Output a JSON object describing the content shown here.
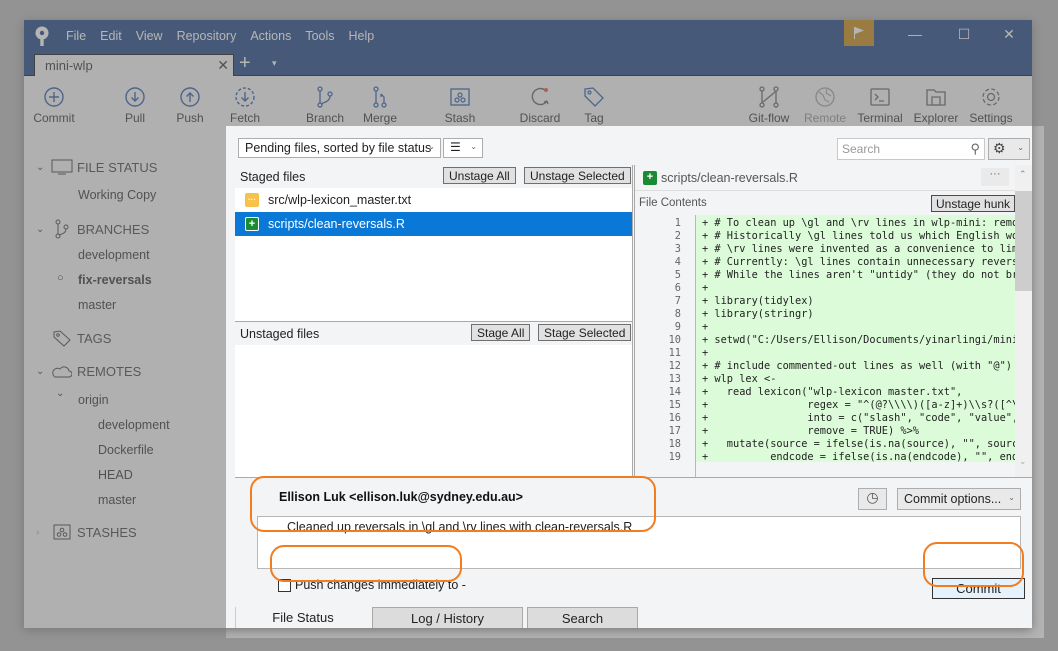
{
  "app": {
    "menu": [
      "File",
      "Edit",
      "View",
      "Repository",
      "Actions",
      "Tools",
      "Help"
    ],
    "window_controls": {
      "minimize": "—",
      "maximize": "☐",
      "close": "✕"
    },
    "flag_color": "#c47f00",
    "titlebar_color": "#0b3478"
  },
  "tabs": {
    "repo_tab": "mini-wlp",
    "close_glyph": "✕",
    "add_glyph": "+",
    "dropdown_glyph": "▾"
  },
  "toolbar": {
    "items": [
      {
        "label": "Commit",
        "icon": "commit-icon"
      },
      {
        "label": "Pull",
        "icon": "pull-icon"
      },
      {
        "label": "Push",
        "icon": "push-icon"
      },
      {
        "label": "Fetch",
        "icon": "fetch-icon"
      },
      {
        "label": "Branch",
        "icon": "branch-icon"
      },
      {
        "label": "Merge",
        "icon": "merge-icon"
      },
      {
        "label": "Stash",
        "icon": "stash-icon"
      },
      {
        "label": "Discard",
        "icon": "discard-icon"
      },
      {
        "label": "Tag",
        "icon": "tag-icon"
      },
      {
        "label": "Git-flow",
        "icon": "git-flow-icon"
      },
      {
        "label": "Remote",
        "icon": "globe-icon",
        "disabled": true
      },
      {
        "label": "Terminal",
        "icon": "terminal-icon"
      },
      {
        "label": "Explorer",
        "icon": "folder-icon"
      },
      {
        "label": "Settings",
        "icon": "gear-icon"
      }
    ]
  },
  "sidebar": {
    "file_status": {
      "title": "FILE STATUS",
      "items": [
        "Working Copy"
      ]
    },
    "branches": {
      "title": "BRANCHES",
      "items": [
        "development",
        "fix-reversals",
        "master"
      ],
      "current": "fix-reversals",
      "current_marker": "○"
    },
    "tags": {
      "title": "TAGS"
    },
    "remotes": {
      "title": "REMOTES",
      "origin": "origin",
      "items": [
        "development",
        "Dockerfile",
        "HEAD",
        "master"
      ]
    },
    "stashes": {
      "title": "STASHES"
    }
  },
  "main": {
    "filter_select": "Pending files, sorted by file status",
    "view_select_glyph": "☰",
    "search_placeholder": "Search",
    "staged": {
      "title": "Staged files",
      "unstage_all": "Unstage All",
      "unstage_selected": "Unstage Selected",
      "files": [
        {
          "name": "src/wlp-lexicon_master.txt",
          "status": "modified",
          "glyph": "···"
        },
        {
          "name": "scripts/clean-reversals.R",
          "status": "added",
          "glyph": "+",
          "selected": true
        }
      ]
    },
    "unstaged": {
      "title": "Unstaged files",
      "stage_all": "Stage All",
      "stage_selected": "Stage Selected",
      "files": []
    },
    "diff": {
      "file": "scripts/clean-reversals.R",
      "more_glyph": "···",
      "section_label": "File Contents",
      "unstage_hunk": "Unstage hunk",
      "lines": [
        {
          "n": "1",
          "t": "+ # To clean up \\gl and \\rv lines in wlp-mini: remov"
        },
        {
          "n": "2",
          "t": "+ # Historically \\gl lines told us which English wor"
        },
        {
          "n": "3",
          "t": "+ # \\rv lines were invented as a convenience to limi"
        },
        {
          "n": "4",
          "t": "+ # Currently: \\gl lines contain unnecessary reversa"
        },
        {
          "n": "5",
          "t": "+ # While the lines aren't \"untidy\" (they do not bre"
        },
        {
          "n": "6",
          "t": "+"
        },
        {
          "n": "7",
          "t": "+ library(tidylex)"
        },
        {
          "n": "8",
          "t": "+ library(stringr)"
        },
        {
          "n": "9",
          "t": "+"
        },
        {
          "n": "10",
          "t": "+ setwd(\"C:/Users/Ellison/Documents/yinarlingi/mini-"
        },
        {
          "n": "11",
          "t": "+"
        },
        {
          "n": "12",
          "t": "+ # include commented-out lines as well (with \"@\")"
        },
        {
          "n": "13",
          "t": "+ wlp_lex <-"
        },
        {
          "n": "14",
          "t": "+   read_lexicon(\"wlp-lexicon_master.txt\","
        },
        {
          "n": "15",
          "t": "+                regex = \"^(@?\\\\\\\\)([a-z]+)\\\\s?([^\\\\"
        },
        {
          "n": "16",
          "t": "+                into = c(\"slash\", \"code\", \"value\","
        },
        {
          "n": "17",
          "t": "+                remove = TRUE) %>%"
        },
        {
          "n": "18",
          "t": "+   mutate(source = ifelse(is.na(source), \"\", source"
        },
        {
          "n": "19",
          "t": "+          endcode = ifelse(is.na(endcode), \"\", endc"
        }
      ]
    },
    "commit": {
      "author": "Ellison Luk <ellison.luk@sydney.edu.au>",
      "message": "Cleaned up reversals in \\gl and \\rv lines with clean-reversals.R",
      "options_label": "Commit options...",
      "push_label": "Push changes immediately to -",
      "push_checked": false,
      "commit_button": "Commit"
    },
    "bottom_tabs": [
      "File Status",
      "Log / History",
      "Search"
    ],
    "active_bottom_tab": "File Status"
  },
  "highlight_color": "#f37c1e"
}
